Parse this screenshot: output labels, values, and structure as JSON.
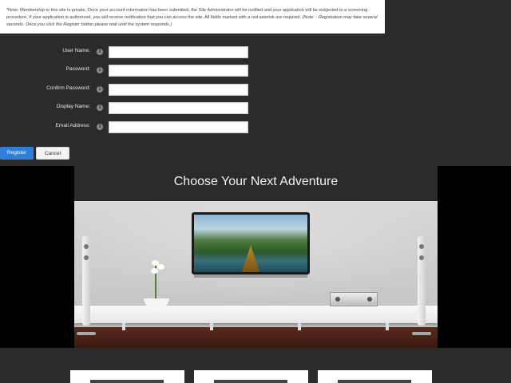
{
  "notice": {
    "text": "*Note: Membership to this site is private. Once your account information has been submitted, the Site Administrator will be notified and your application will be subjected to a screening procedure. If your application is authorized, you will receive notification that you can access the site. All fields marked with a red asterisk are required.",
    "italic_text": "(Note: - Registration may take several seconds. Once you click the Register button please wait until the system responds.)"
  },
  "form": {
    "fields": [
      {
        "label": "User Name:",
        "value": ""
      },
      {
        "label": "Password:",
        "value": ""
      },
      {
        "label": "Confirm Password:",
        "value": ""
      },
      {
        "label": "Display Name:",
        "value": ""
      },
      {
        "label": "Email Address:",
        "value": ""
      }
    ],
    "info_icon": "info-icon",
    "info_glyph": "i",
    "register_label": "Register",
    "cancel_label": "Cancel"
  },
  "hero": {
    "title": "Choose Your Next Adventure"
  },
  "colors": {
    "background": "#2b2b2b",
    "register_button": "#2f7fd6",
    "notice_bg": "#ffffff"
  }
}
